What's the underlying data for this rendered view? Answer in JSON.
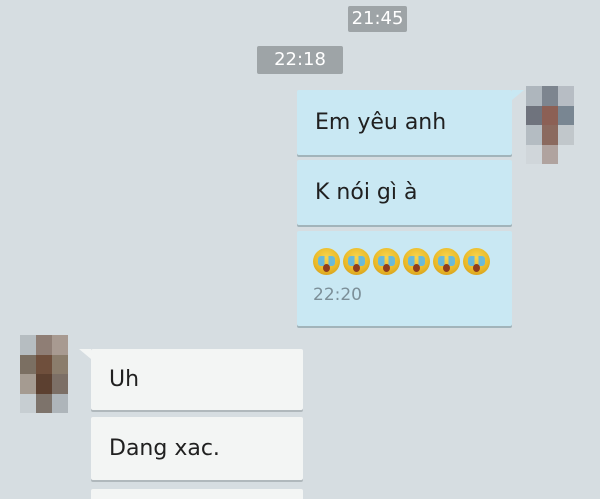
{
  "conversation": {
    "timestamps": [
      "21:45",
      "22:18"
    ],
    "messages": [
      {
        "direction": "outgoing",
        "text": "Em yêu anh"
      },
      {
        "direction": "outgoing",
        "text": "K nói gì à"
      },
      {
        "direction": "outgoing",
        "emoji_count": 6,
        "emoji_icon": "crying-face-emoji",
        "time": "22:20"
      },
      {
        "direction": "incoming",
        "text": "Uh"
      },
      {
        "direction": "incoming",
        "text": "Dang xac."
      }
    ]
  },
  "avatars": {
    "right": "blurred-user-avatar",
    "left": "blurred-contact-avatar"
  },
  "colors": {
    "background": "#d6dde1",
    "timestamp_pill": "#9ea4a7",
    "outgoing_bubble": "#c9e8f3",
    "incoming_bubble": "#f3f5f4",
    "message_time": "#7c8f98"
  }
}
